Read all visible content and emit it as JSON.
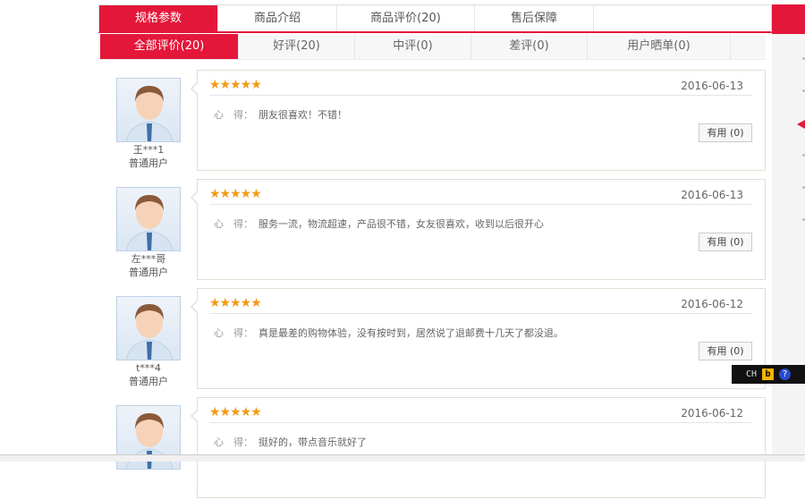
{
  "main_tabs": [
    "规格参数",
    "商品介绍",
    "商品评价(20)",
    "售后保障"
  ],
  "sub_tabs": [
    "全部评价(20)",
    "好评(20)",
    "中评(0)",
    "差评(0)",
    "用户晒单(0)"
  ],
  "reviews": [
    {
      "user": "王***1",
      "level": "普通用户",
      "stars": 5,
      "date": "2016-06-13",
      "label": "心　得：",
      "text": "朋友很喜欢！不错！",
      "useful": "有用 (0)"
    },
    {
      "user": "左***哥",
      "level": "普通用户",
      "stars": 5,
      "date": "2016-06-13",
      "label": "心　得：",
      "text": "服务一流，物流超速，产品很不错，女友很喜欢，收到以后很开心",
      "useful": "有用 (0)"
    },
    {
      "user": "t***4",
      "level": "普通用户",
      "stars": 5,
      "date": "2016-06-12",
      "label": "心　得：",
      "text": "真是最差的购物体验，没有按时到，居然说了退邮费十几天了都没退。",
      "useful": "有用 (0)"
    },
    {
      "user": "",
      "level": "",
      "stars": 5,
      "date": "2016-06-12",
      "label": "心　得：",
      "text": "挺好的，带点音乐就好了",
      "useful": ""
    }
  ],
  "ime": {
    "lang": "CH"
  },
  "colors": {
    "accent": "#e4173a",
    "star": "#f39a13"
  }
}
